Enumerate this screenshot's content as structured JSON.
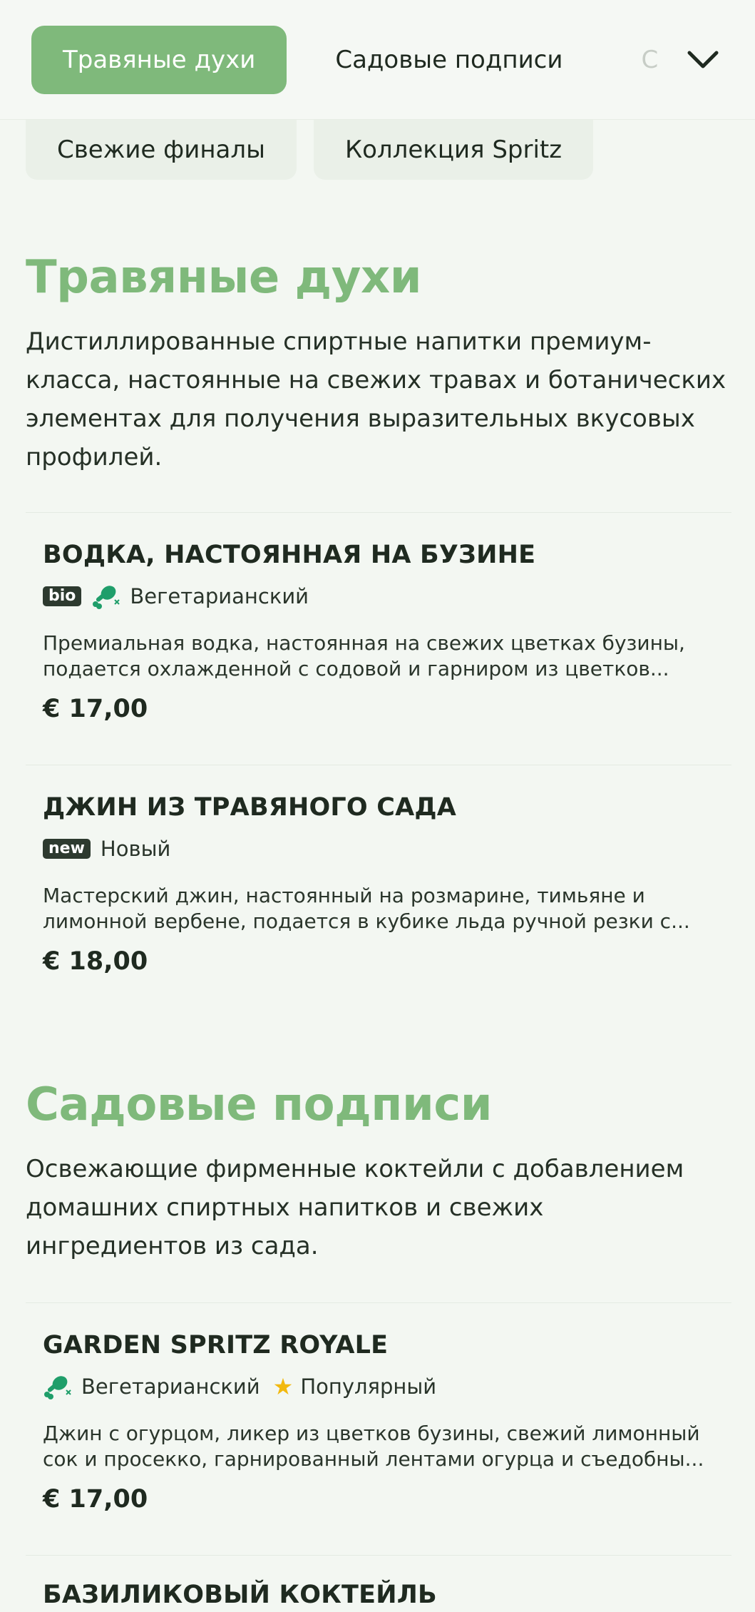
{
  "nav": {
    "tabs": [
      {
        "label": "Травяные духи",
        "active": true
      },
      {
        "label": "Садовые подписи"
      },
      {
        "label": "Св"
      }
    ],
    "tabs_row2": [
      {
        "label": "Свежие финалы"
      },
      {
        "label": "Коллекция Spritz"
      }
    ],
    "expand_icon": "chevron-down-icon"
  },
  "sections": [
    {
      "title": "Травяные духи",
      "description": "Дистиллированные спиртные напитки премиум-класса, настоянные на свежих травах и ботанических элементах для получения выразительных вкусовых профилей.",
      "items": [
        {
          "name": "ВОДКА, НАСТОЯННАЯ НА БУЗИНЕ",
          "badge": "bio",
          "tag": "Вегетарианский",
          "tag_icon": "vegetarian-drumstick-icon",
          "description": "Премиальная водка, настоянная на свежих цветках бузины, подается охлажденной с содовой и гарниром из цветков...",
          "price": "€ 17,00"
        },
        {
          "name": "ДЖИН ИЗ ТРАВЯНОГО САДА",
          "badge": "new",
          "tag": "Новый",
          "description": "Мастерский джин, настоянный на розмарине, тимьяне и лимонной вербене, подается в кубике льда ручной резки с...",
          "price": "€ 18,00"
        }
      ]
    },
    {
      "title": "Садовые подписи",
      "description": "Освежающие фирменные коктейли с добавлением домашних спиртных напитков и свежих ингредиентов из сада.",
      "items": [
        {
          "name": "GARDEN SPRITZ ROYALE",
          "tag": "Вегетарианский",
          "tag_icon": "vegetarian-drumstick-icon",
          "tag2": "Популярный",
          "tag2_icon": "star-icon",
          "description": "Джин с огурцом, ликер из цветков бузины, свежий лимонный сок и просекко, гарнированный лентами огурца и съедобны...",
          "price": "€ 17,00"
        },
        {
          "name": "БАЗИЛИКОВЫЙ КОКТЕЙЛЬ"
        }
      ]
    }
  ],
  "colors": {
    "accent": "#7fb97b",
    "background": "#f3f7f2",
    "badge": "#2d3a2f",
    "veg_icon": "#1f9e6a",
    "star": "#f2b90f"
  }
}
